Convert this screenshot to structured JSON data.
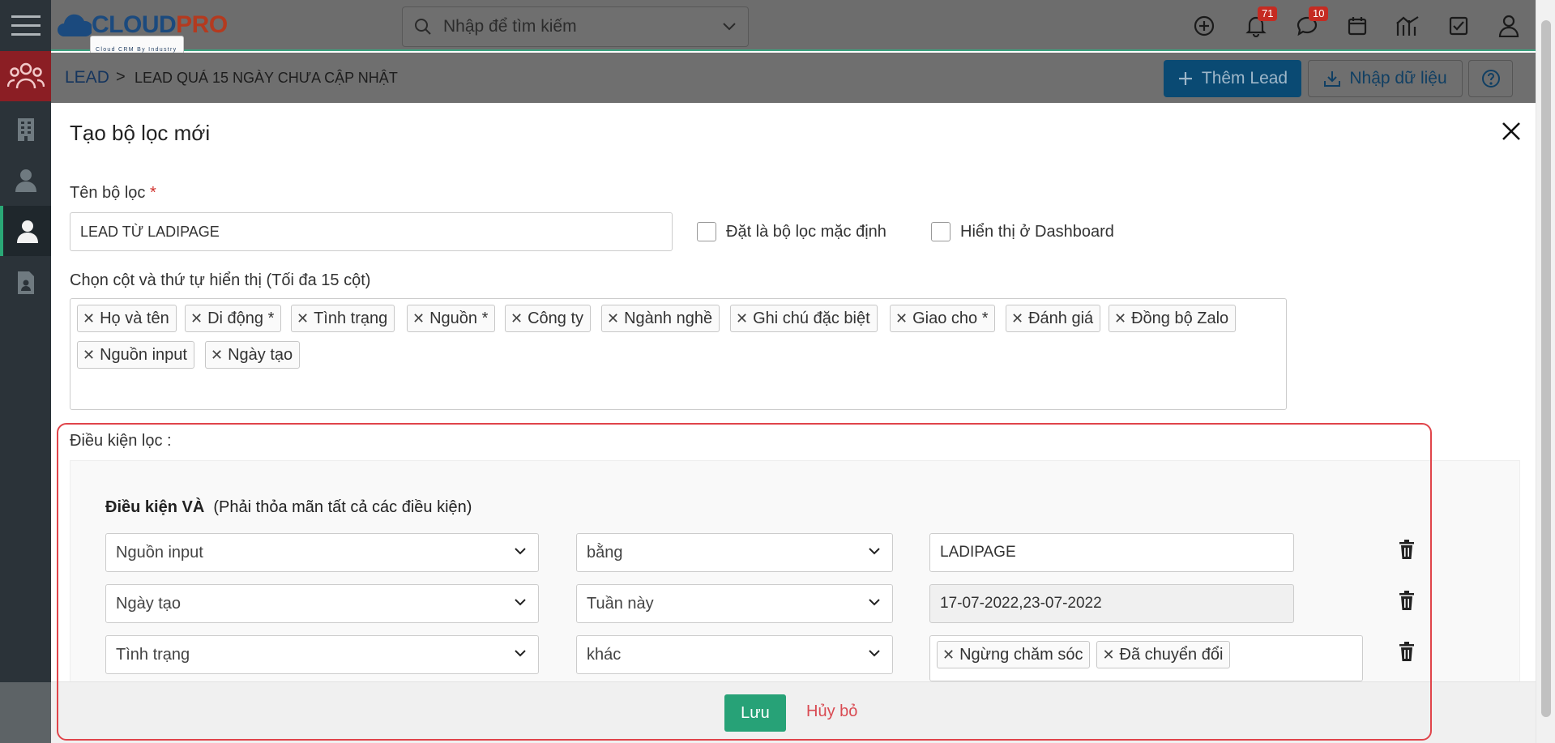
{
  "topbar": {
    "logo_text_a": "CLOUD",
    "logo_text_b": "PRO",
    "logo_tagline": "Cloud CRM By Industry",
    "search_placeholder": "Nhập để tìm kiếm",
    "notifications_count": "71",
    "messages_count": "10"
  },
  "breadcrumb": {
    "module": "LEAD",
    "separator": ">",
    "current": "LEAD QUÁ 15 NGÀY CHƯA CẬP NHẬT"
  },
  "actions": {
    "add_lead": "Thêm Lead",
    "import": "Nhập dữ liệu"
  },
  "modal": {
    "title": "Tạo bộ lọc mới",
    "filter_name_label": "Tên bộ lọc",
    "required_mark": "*",
    "filter_name_value": "LEAD TỪ LADIPAGE",
    "set_default_label": "Đặt là bộ lọc mặc định",
    "show_dashboard_label": "Hiển thị ở Dashboard",
    "columns_label": "Chọn cột và thứ tự hiển thị (Tối đa 15 cột)",
    "columns": [
      "Họ và tên",
      "Di động *",
      "Tình trạng",
      "Nguồn *",
      "Công ty",
      "Ngành nghề",
      "Ghi chú đặc biệt",
      "Giao cho *",
      "Đánh giá",
      "Đồng bộ Zalo",
      "Nguồn input",
      "Ngày tạo"
    ],
    "conditions_label": "Điều kiện lọc :",
    "and_title": "Điều kiện VÀ",
    "and_note": "(Phải thỏa mãn tất cả các điều kiện)",
    "conditions": [
      {
        "field": "Nguồn input",
        "operator": "bằng",
        "value": "LADIPAGE"
      },
      {
        "field": "Ngày tạo",
        "operator": "Tuần này",
        "value": "17-07-2022,23-07-2022"
      },
      {
        "field": "Tình trạng",
        "operator": "khác",
        "tags": [
          "Ngừng chăm sóc",
          "Đã chuyển đổi"
        ]
      }
    ],
    "save": "Lưu",
    "cancel": "Hủy bỏ"
  },
  "colors": {
    "sidebar_bg": "#2b3339",
    "primary": "#0a4a73",
    "success": "#27a277",
    "danger": "#d94a52",
    "highlight": "#e0444a"
  }
}
